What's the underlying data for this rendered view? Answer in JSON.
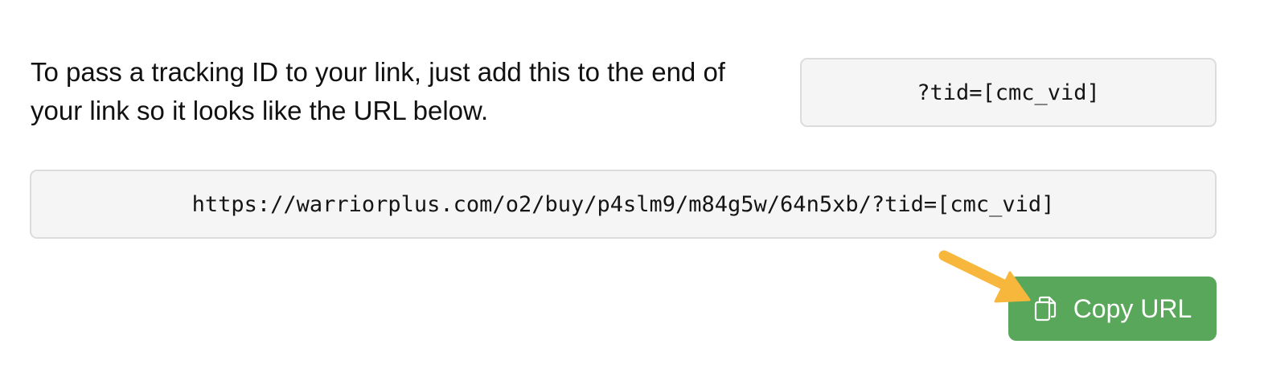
{
  "instructions": {
    "text": "To pass a tracking ID to your link, just add this to the end of your link so it looks like the URL below."
  },
  "tracking_param": {
    "value": "?tid=[cmc_vid]"
  },
  "tracking_url": {
    "value": "https://warriorplus.com/o2/buy/p4slm9/m84g5w/64n5xb/?tid=[cmc_vid]"
  },
  "copy_button": {
    "label": "Copy URL",
    "icon": "copy-icon",
    "color": "#59a75a"
  },
  "annotation": {
    "icon": "arrow-pointer-icon",
    "color": "#f6b73c"
  }
}
